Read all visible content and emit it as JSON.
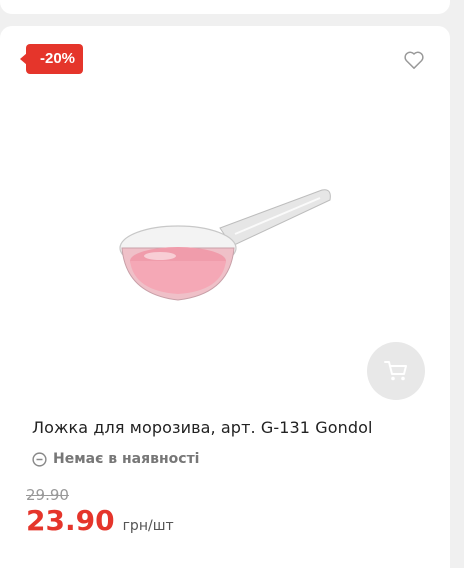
{
  "product": {
    "discount_badge": "-20%",
    "title": "Ложка для морозива, арт. G-131 Gondol",
    "availability": "Немає в наявності",
    "old_price": "29.90",
    "price": "23.90",
    "unit": "грн/шт"
  },
  "icons": {
    "favorite": "heart-icon",
    "cart": "cart-icon",
    "availability": "minus-circle-icon"
  },
  "colors": {
    "accent": "#e5352b",
    "muted": "#777777",
    "cart_bg": "#e8e8e8"
  }
}
